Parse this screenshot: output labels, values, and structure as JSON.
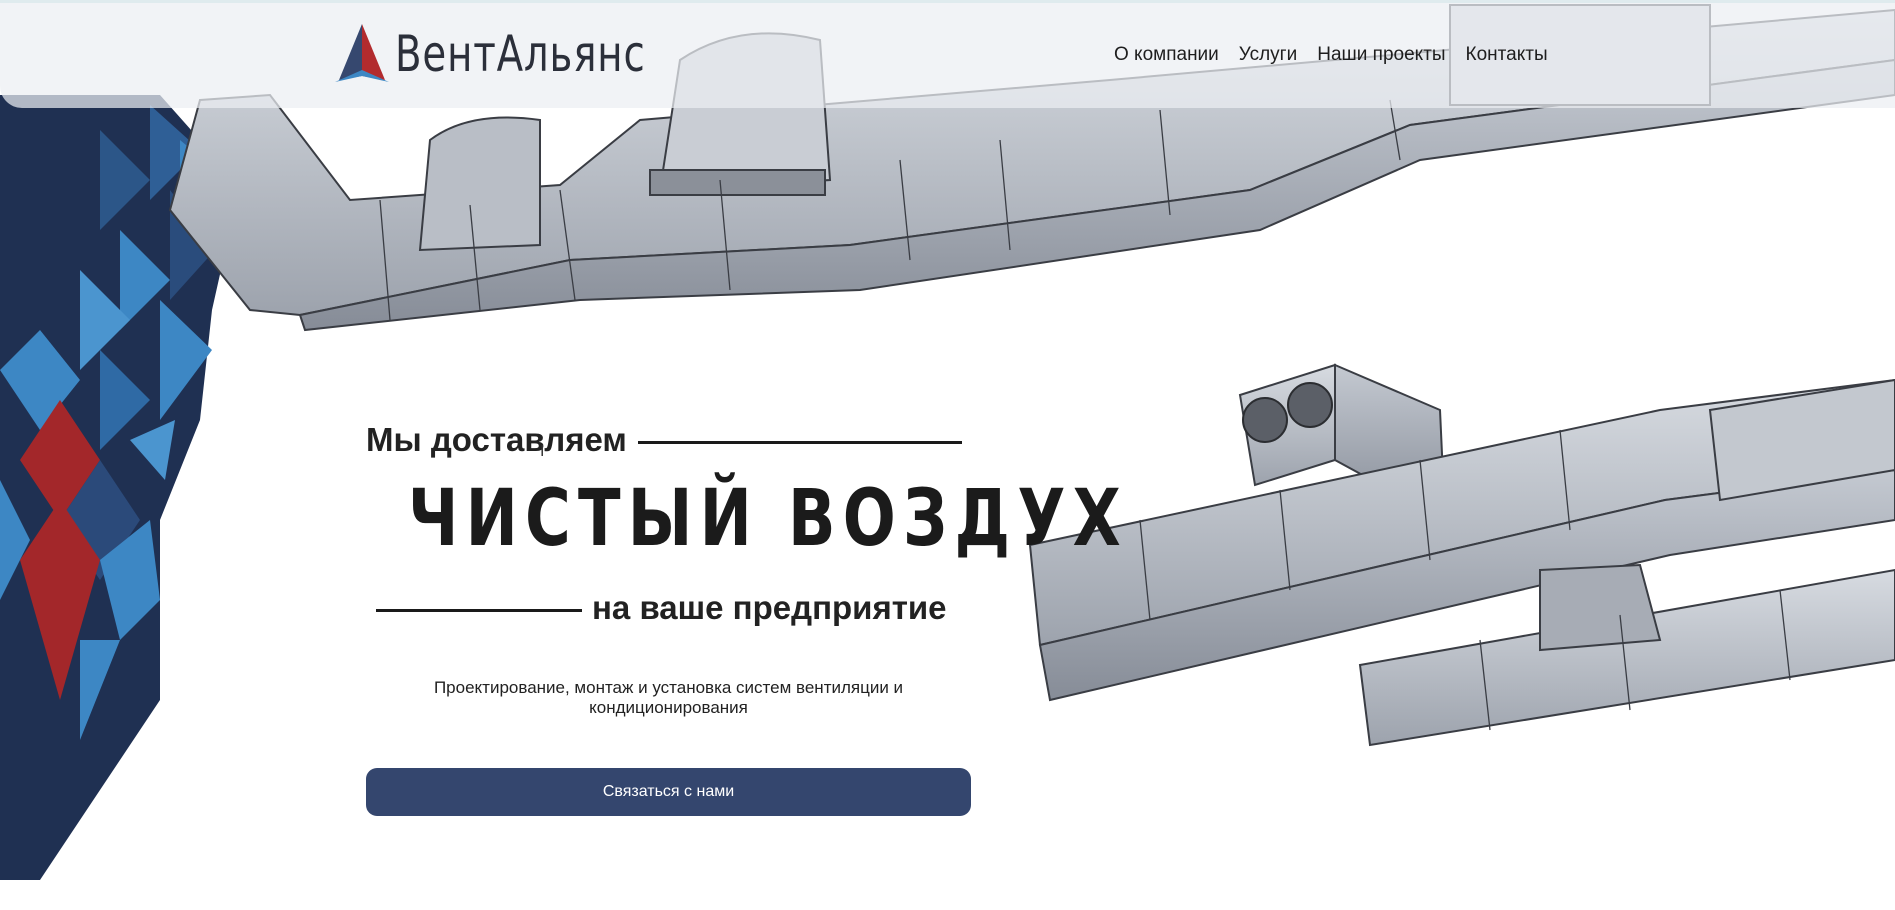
{
  "brand": {
    "name": "ВентАльянс"
  },
  "nav": {
    "items": [
      {
        "label": "О компании"
      },
      {
        "label": "Услуги"
      },
      {
        "label": "Наши проекты"
      },
      {
        "label": "Контакты"
      }
    ]
  },
  "hero": {
    "line1": "Мы доставляем",
    "title": "ЧИСТЫЙ ВОЗДУХ",
    "line3": "на ваше предприятие",
    "description": "Проектирование, монтаж и установка систем вентиляции и кондиционирования",
    "cta_label": "Связаться с нами"
  },
  "colors": {
    "accent_navy": "#34466e",
    "deco_dark": "#1f3052",
    "deco_blue": "#3d87c4",
    "deco_red": "#a3272a"
  }
}
